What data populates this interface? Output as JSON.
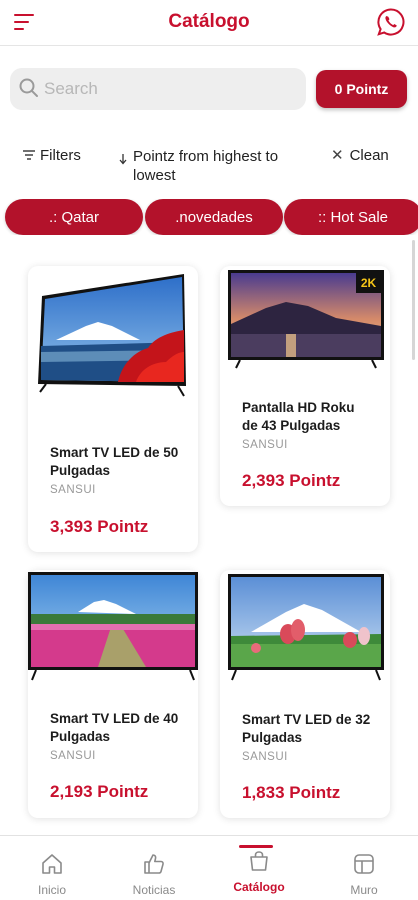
{
  "header": {
    "title": "Catálogo",
    "menu_icon": "hamburger-icon",
    "whatsapp_icon": "whatsapp-icon"
  },
  "search": {
    "placeholder": "Search",
    "value": ""
  },
  "points_button": {
    "label": "0 Pointz"
  },
  "toolbar": {
    "filters_label": "Filters",
    "sort_label": "Pointz from highest to lowest",
    "clean_label": "Clean"
  },
  "categories": [
    {
      "label": ".: Qatar"
    },
    {
      "label": ".novedades"
    },
    {
      "label": ":: Hot Sale"
    }
  ],
  "products": [
    {
      "name": "Smart TV LED de 50 Pulgadas",
      "brand": "SANSUI",
      "price": "3,393 Pointz"
    },
    {
      "name": "Pantalla HD Roku de 43 Pulgadas",
      "brand": "SANSUI",
      "price": "2,393 Pointz",
      "badge": "2K"
    },
    {
      "name": "Smart TV LED de 40 Pulgadas",
      "brand": "SANSUI",
      "price": "2,193 Pointz"
    },
    {
      "name": "Smart TV LED de 32 Pulgadas",
      "brand": "SANSUI",
      "price": "1,833 Pointz"
    }
  ],
  "bottom_nav": [
    {
      "label": "Inicio",
      "icon": "home-icon",
      "active": false
    },
    {
      "label": "Noticias",
      "icon": "thumbs-up-icon",
      "active": false
    },
    {
      "label": "Catálogo",
      "icon": "shopping-bag-icon",
      "active": true
    },
    {
      "label": "Muro",
      "icon": "layout-icon",
      "active": false
    }
  ],
  "colors": {
    "accent": "#c8102e",
    "button": "#b3122b",
    "search_bg": "#eeeeee"
  }
}
